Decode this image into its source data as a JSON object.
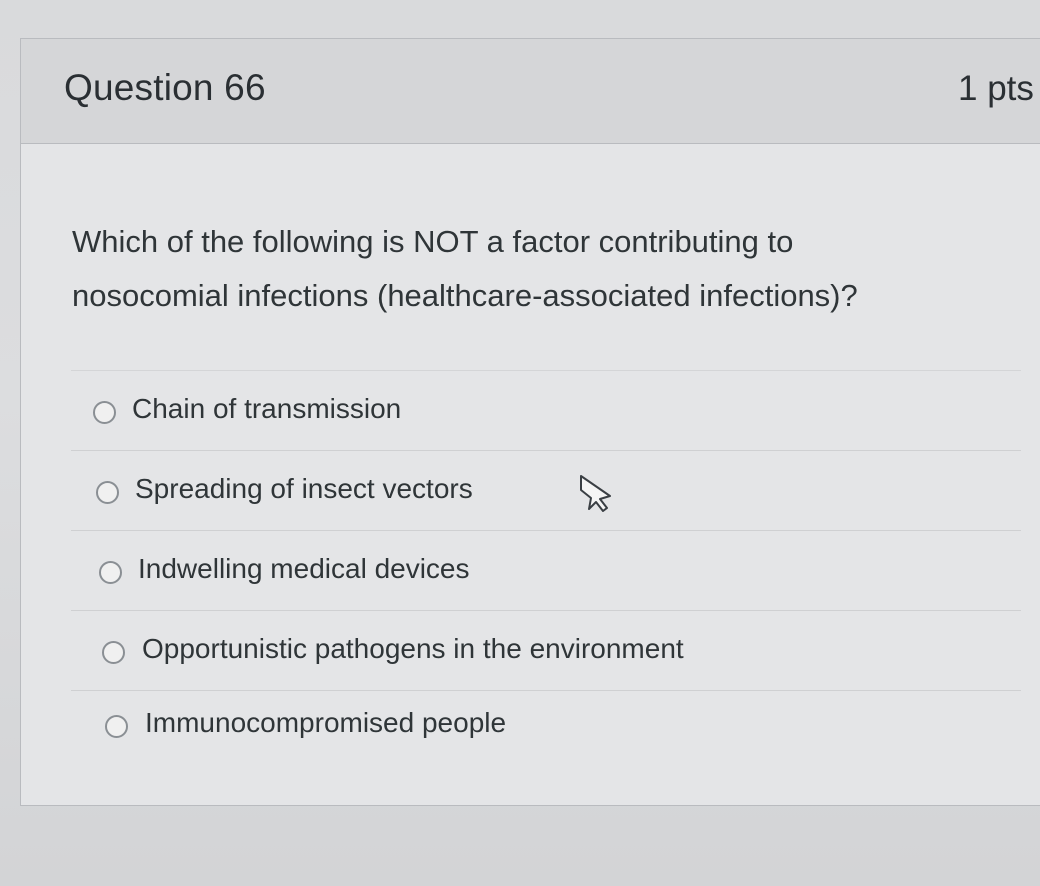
{
  "question": {
    "title": "Question 66",
    "points": "1 pts",
    "text": "Which of the following is NOT a factor contributing to nosocomial infections (healthcare-associated infections)?",
    "answers": [
      {
        "label": "Chain of transmission"
      },
      {
        "label": "Spreading of insect vectors"
      },
      {
        "label": "Indwelling medical devices"
      },
      {
        "label": "Opportunistic pathogens in the environment"
      },
      {
        "label": "Immunocompromised people"
      }
    ]
  },
  "icons": {
    "radio": "radio-button-unselected-icon",
    "cursor": "mouse-pointer-icon"
  },
  "colors": {
    "header_background": "#d5d6d8",
    "card_background": "#e4e5e7",
    "text": "#2f3538"
  }
}
